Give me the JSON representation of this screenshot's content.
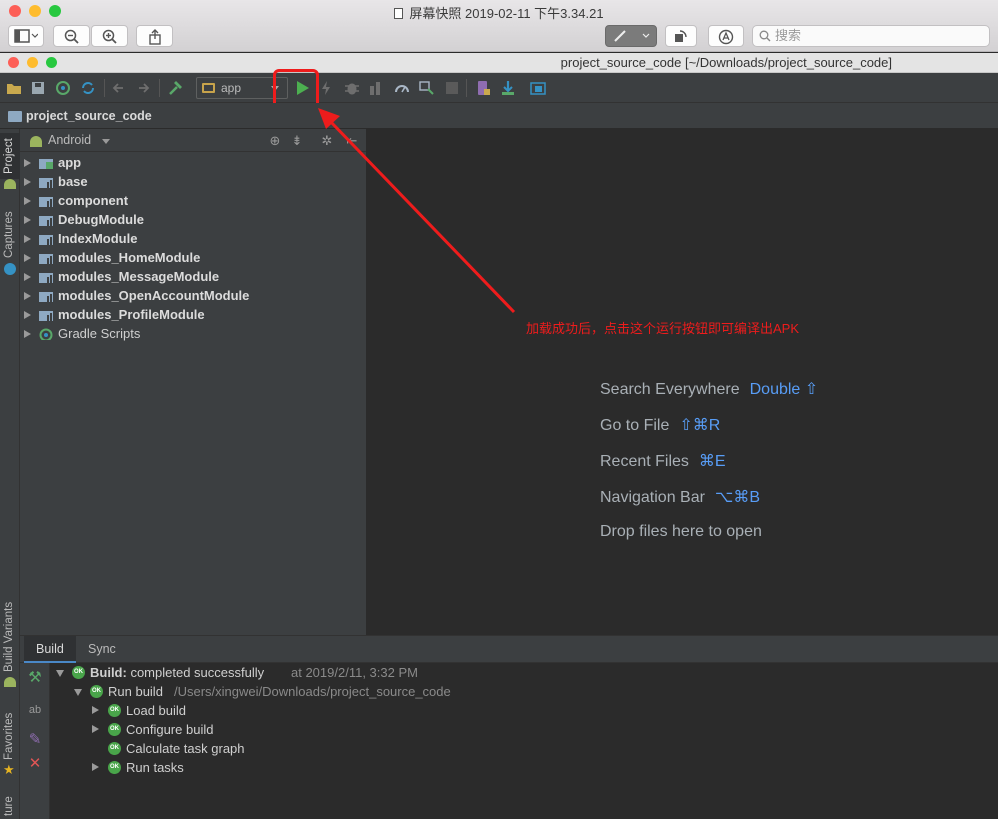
{
  "preview": {
    "title": "屏幕快照 2019-02-11 下午3.34.21",
    "search_placeholder": "搜索"
  },
  "ide": {
    "window_title": "project_source_code [~/Downloads/project_source_code]",
    "run_config": "app",
    "breadcrumb": "project_source_code"
  },
  "left_tool_windows": [
    "Project",
    "Captures",
    "Build Variants",
    "Favorites",
    "ture"
  ],
  "project_panel": {
    "view_mode": "Android",
    "items": [
      {
        "label": "app",
        "icon": "app-module-icon"
      },
      {
        "label": "base",
        "icon": "module-icon"
      },
      {
        "label": "component",
        "icon": "module-icon"
      },
      {
        "label": "DebugModule",
        "icon": "module-icon"
      },
      {
        "label": "IndexModule",
        "icon": "module-icon"
      },
      {
        "label": "modules_HomeModule",
        "icon": "module-icon"
      },
      {
        "label": "modules_MessageModule",
        "icon": "module-icon"
      },
      {
        "label": "modules_OpenAccountModule",
        "icon": "module-icon"
      },
      {
        "label": "modules_ProfileModule",
        "icon": "module-icon"
      },
      {
        "label": "Gradle Scripts",
        "icon": "gradle-icon"
      }
    ]
  },
  "editor_hints": [
    {
      "label": "Search Everywhere",
      "shortcut": "Double ⇧"
    },
    {
      "label": "Go to File",
      "shortcut": "⇧⌘R"
    },
    {
      "label": "Recent Files",
      "shortcut": "⌘E"
    },
    {
      "label": "Navigation Bar",
      "shortcut": "⌥⌘B"
    },
    {
      "label": "Drop files here to open",
      "shortcut": ""
    }
  ],
  "annotation": "加载成功后，点击这个运行按钮即可编译出APK",
  "build_panel": {
    "tabs": [
      "Build",
      "Sync"
    ],
    "build_label": "Build:",
    "build_status": "completed successfully",
    "build_time": "at 2019/2/11, 3:32 PM",
    "run_build_label": "Run build",
    "run_build_path": "/Users/xingwei/Downloads/project_source_code",
    "steps": [
      "Load build",
      "Configure build",
      "Calculate task graph",
      "Run tasks"
    ],
    "ok_badge": "OK"
  },
  "colors": {
    "accent_red": "#ee1c1c",
    "shortcut_blue": "#589df6",
    "run_green": "#4caf50"
  }
}
